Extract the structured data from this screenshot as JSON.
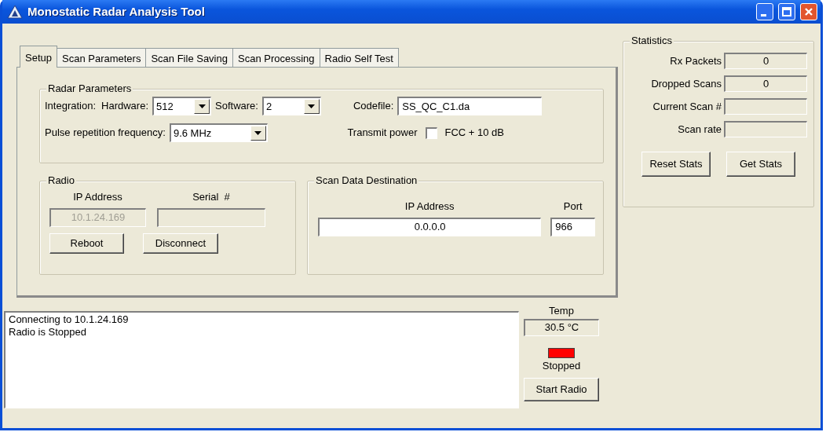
{
  "window": {
    "title": "Monostatic Radar Analysis Tool"
  },
  "tabs": [
    {
      "label": "Setup",
      "selected": true
    },
    {
      "label": "Scan Parameters",
      "selected": false
    },
    {
      "label": "Scan File Saving",
      "selected": false
    },
    {
      "label": "Scan Processing",
      "selected": false
    },
    {
      "label": "Radio Self Test",
      "selected": false
    }
  ],
  "radar_parameters": {
    "title": "Radar Parameters",
    "integration_label": "Integration:",
    "hardware_label": "Hardware:",
    "hardware": "512",
    "software_label": "Software:",
    "software": "2",
    "codefile_label": "Codefile:",
    "codefile": "SS_QC_C1.da",
    "prf_label": "Pulse repetition frequency:",
    "prf": "9.6 MHz",
    "transmit_power_label": "Transmit power",
    "fcc_label": "FCC + 10 dB",
    "fcc_checked": false
  },
  "radio": {
    "title": "Radio",
    "ip_label": "IP Address",
    "ip": "10.1.24.169",
    "ip_disabled": true,
    "serial_label": "Serial  #",
    "buttons": [
      "Reboot",
      "Disconnect"
    ]
  },
  "destination": {
    "title": "Scan Data Destination",
    "ip_label": "IP Address",
    "ip": "0.0.0.0",
    "port_label": "Port",
    "port": "966"
  },
  "log": [
    "Connecting to 10.1.24.169",
    "Radio is Stopped"
  ],
  "temp": {
    "label": "Temp",
    "value": "30.5 °C"
  },
  "status": {
    "label": "Stopped",
    "running": false
  },
  "start_button": "Start Radio",
  "statistics": {
    "title": "Statistics",
    "rows": [
      {
        "label": "Rx Packets",
        "value": "0"
      },
      {
        "label": "Dropped Scans",
        "value": "0"
      },
      {
        "label": "Current Scan #"
      },
      {
        "label": "Scan rate"
      }
    ],
    "buttons": [
      "Reset Stats",
      "Get Stats"
    ]
  }
}
